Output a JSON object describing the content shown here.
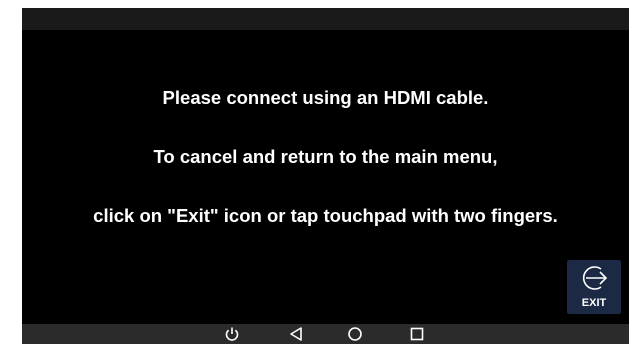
{
  "message": {
    "line1": "Please connect using an HDMI cable.",
    "line2": "To cancel and return to the main menu,",
    "line3": "click on \"Exit\" icon or tap touchpad with two fingers."
  },
  "exit_button": {
    "label": "EXIT",
    "icon": "exit-arrow-icon"
  },
  "nav_bar": {
    "items": [
      {
        "name": "power",
        "icon": "power-icon"
      },
      {
        "name": "back",
        "icon": "back-triangle-icon"
      },
      {
        "name": "home",
        "icon": "home-circle-icon"
      },
      {
        "name": "recent",
        "icon": "recent-apps-square-icon"
      }
    ]
  },
  "colors": {
    "screen_background": "#000000",
    "status_bar": "#1a1a1a",
    "nav_bar": "#2b2b2b",
    "exit_button_background": "#1c2944",
    "text": "#ffffff"
  }
}
